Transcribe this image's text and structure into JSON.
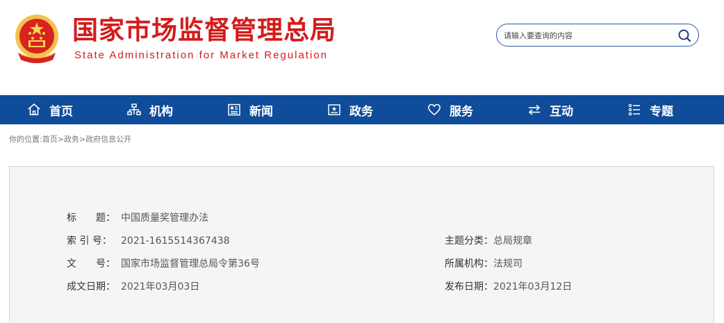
{
  "header": {
    "title_cn": "国家市场监督管理总局",
    "title_en": "State Administration for Market Regulation",
    "brand_color": "#d41b1b"
  },
  "search": {
    "placeholder": "请输入要查询的内容",
    "icon": "search-icon"
  },
  "nav": {
    "background": "#0f4c99",
    "items": [
      {
        "label": "首页",
        "icon": "home-icon"
      },
      {
        "label": "机构",
        "icon": "org-chart-icon"
      },
      {
        "label": "新闻",
        "icon": "news-icon"
      },
      {
        "label": "政务",
        "icon": "government-icon"
      },
      {
        "label": "服务",
        "icon": "heart-icon"
      },
      {
        "label": "互动",
        "icon": "exchange-icon"
      },
      {
        "label": "专题",
        "icon": "list-icon"
      }
    ]
  },
  "breadcrumb": {
    "prefix": "你的位置:",
    "items": [
      "首页",
      "政务",
      "政府信息公开"
    ],
    "separator": ">"
  },
  "info": {
    "title_label": "标　　题：",
    "title_value": "中国质量奖管理办法",
    "index_label": "索 引 号：",
    "index_value": "2021-1615514367438",
    "docno_label": "文　　号：",
    "docno_value": "国家市场监督管理总局令第36号",
    "created_label": "成文日期：",
    "created_value": "2021年03月03日",
    "topic_label": "主题分类：",
    "topic_value": "总局规章",
    "org_label": "所属机构：",
    "org_value": "法规司",
    "published_label": "发布日期：",
    "published_value": "2021年03月12日"
  }
}
